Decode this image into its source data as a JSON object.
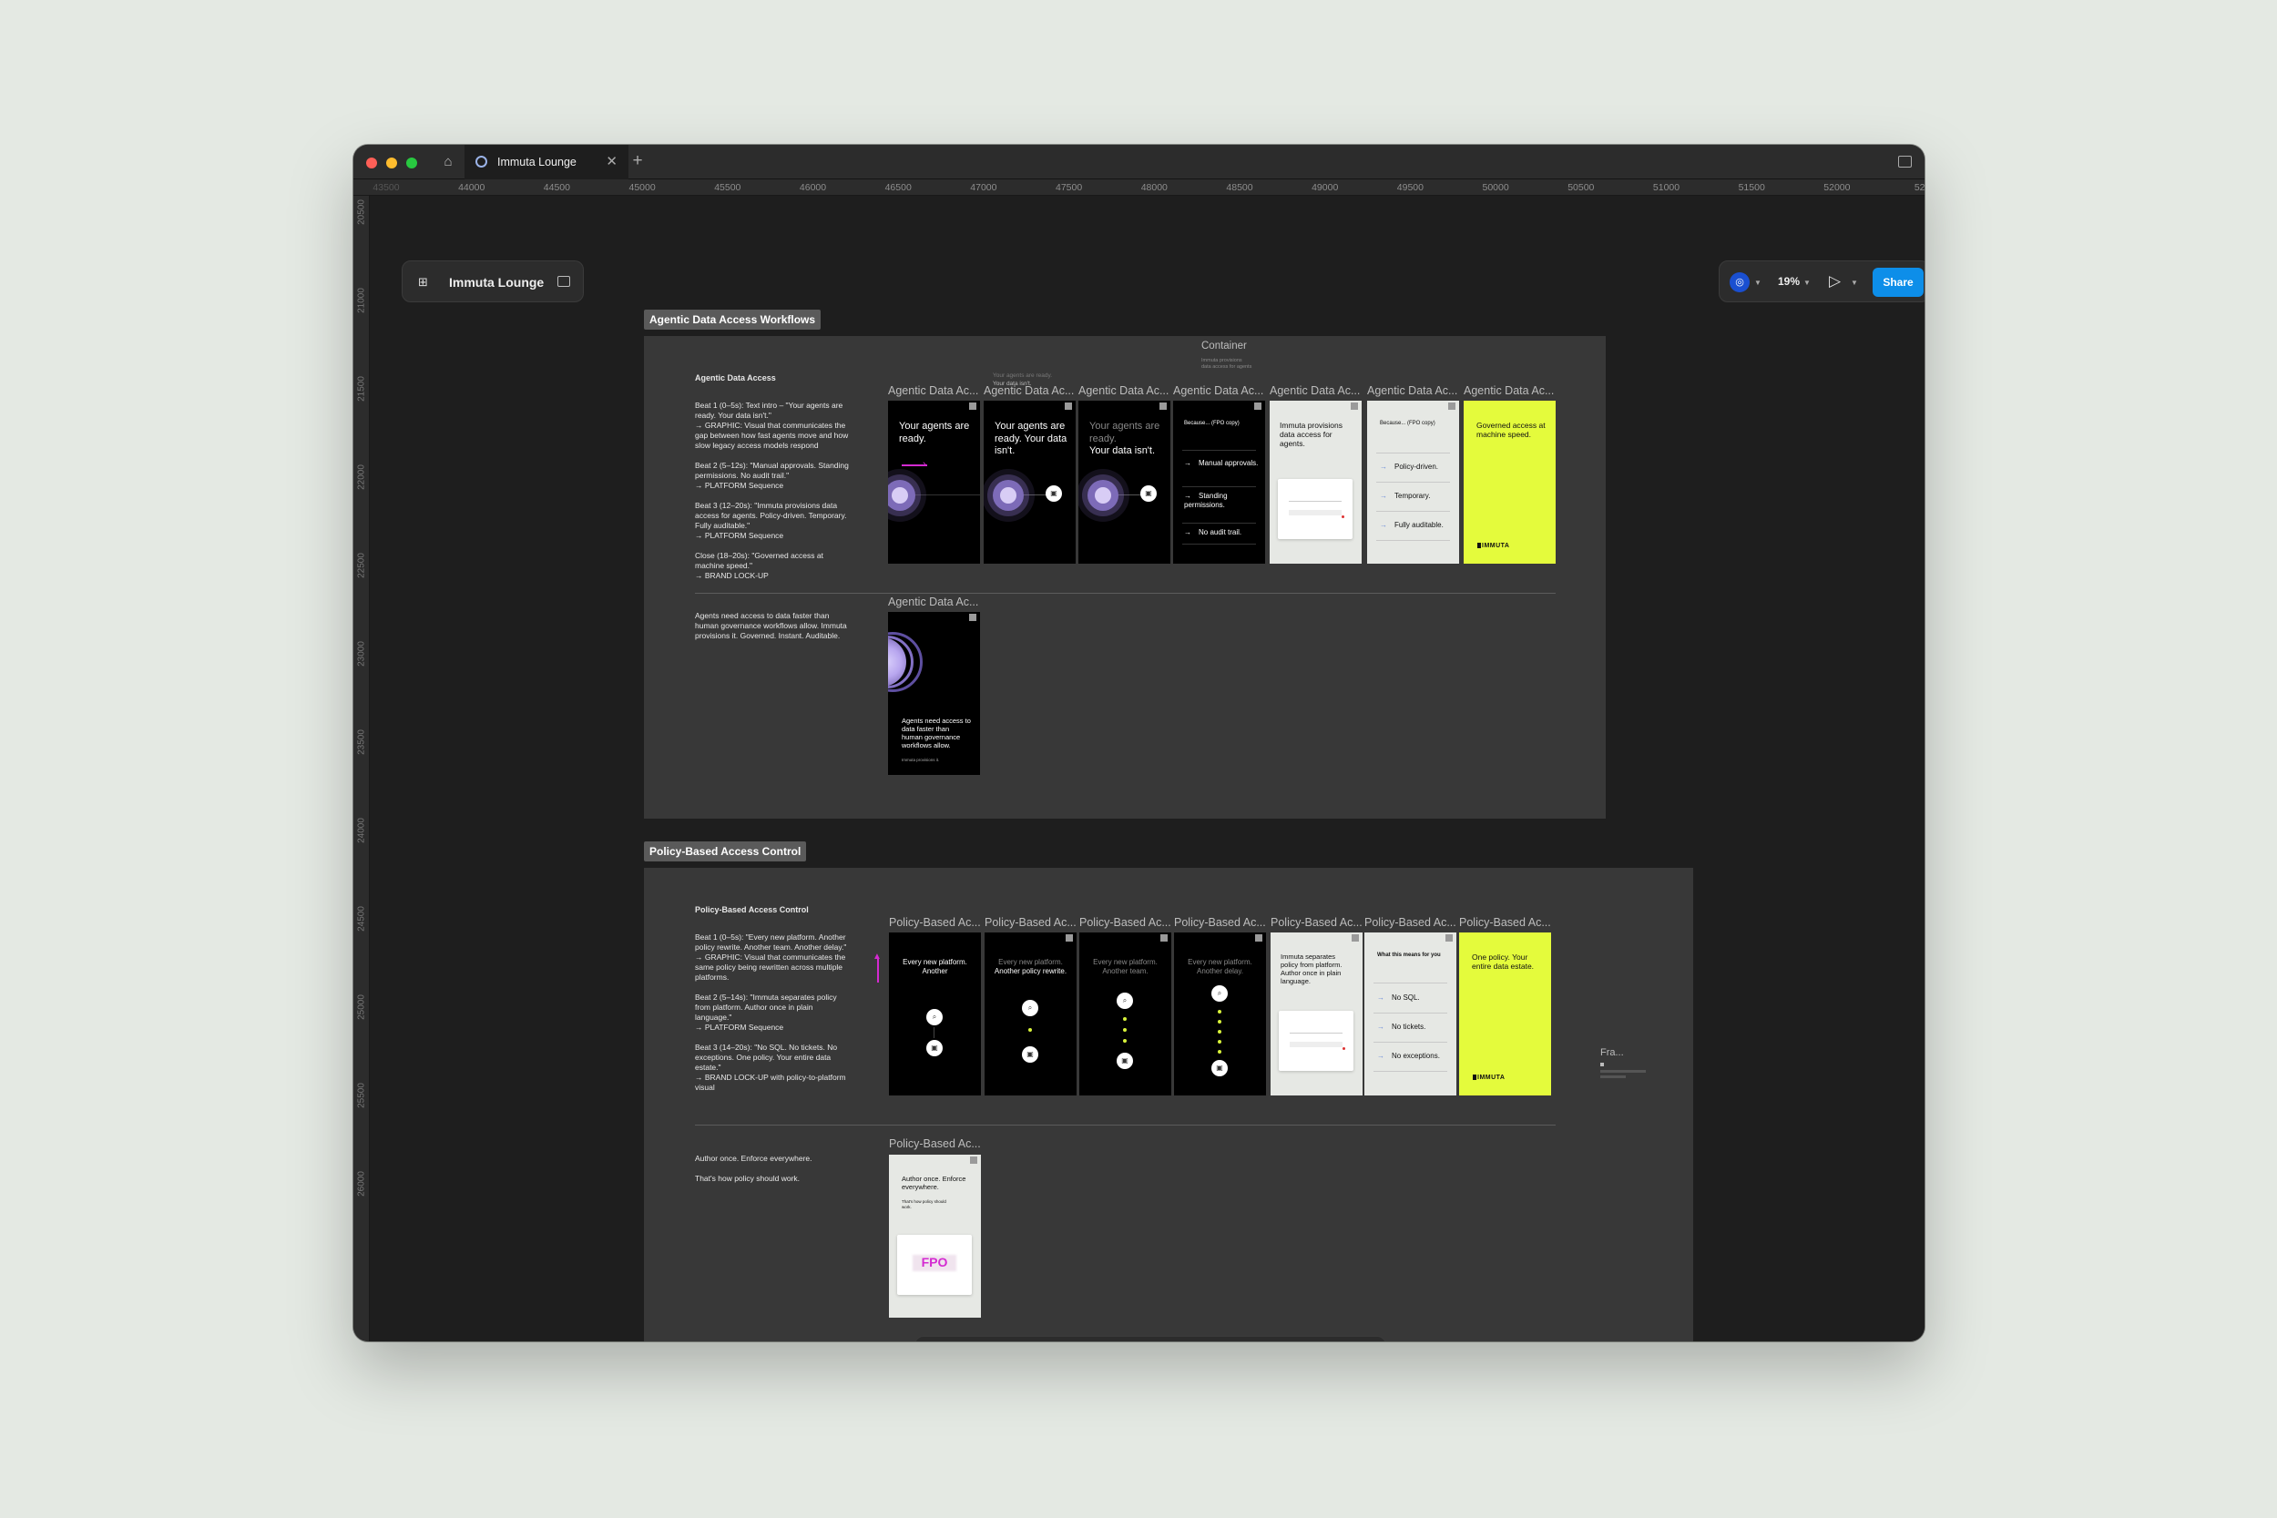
{
  "tab": {
    "title": "Immuta Lounge"
  },
  "ruler": {
    "top": [
      "43500",
      "44000",
      "44500",
      "45000",
      "45500",
      "46000",
      "46500",
      "47000",
      "47500",
      "48000",
      "48500",
      "49000",
      "49500",
      "50000",
      "50500",
      "51000",
      "51500",
      "52000",
      "525"
    ],
    "left": [
      "20500",
      "21000",
      "21500",
      "22000",
      "22500",
      "23000",
      "23500",
      "24000",
      "24500",
      "25000",
      "25500",
      "26000"
    ]
  },
  "file": {
    "name": "Immuta Lounge"
  },
  "toolbar": {
    "zoom": "19%",
    "share": "Share"
  },
  "sections": [
    {
      "label": "Agentic Data Access Workflows",
      "container": {
        "label": "Container",
        "note1": "Immuta provisions",
        "note2": "data access for agents"
      },
      "notes_title": "Agentic Data Access",
      "notes": [
        "Beat 1 (0–5s): Text intro – \"Your agents are ready. Your data isn't.\"",
        "→ GRAPHIC: Visual that communicates the gap between how fast agents move and how slow legacy access models respond",
        "Beat 2 (5–12s): \"Manual approvals. Standing permissions. No audit trail.\"",
        "→ PLATFORM Sequence",
        "Beat 3 (12–20s): \"Immuta provisions data access for agents. Policy-driven. Temporary. Fully auditable.\"",
        "→ PLATFORM Sequence",
        "Close (18–20s): \"Governed access at machine speed.\"",
        "→ BRAND LOCK-UP"
      ],
      "notes2": "Agents need access to data faster than human governance workflows allow. Immuta provisions it. Governed. Instant. Auditable.",
      "frame_label": "Agentic Data Ac...",
      "overlay1": "Your agents are ready.",
      "overlay2": "Your data isn't.",
      "frames": [
        {
          "text": "Your agents are ready."
        },
        {
          "text": "Your agents are ready. Your data isn't."
        },
        {
          "text1": "Your agents are ready.",
          "text2": "Your data isn't."
        },
        {
          "heading": "Because... (FPO copy)",
          "items": [
            "Manual approvals.",
            "Standing permissions.",
            "No audit trail."
          ]
        },
        {
          "text": "Immuta provisions data access for agents."
        },
        {
          "heading": "Because... (FPO copy)",
          "items": [
            "Policy-driven.",
            "Temporary.",
            "Fully auditable."
          ]
        },
        {
          "text": "Governed access at machine speed.",
          "brand": "IMMUTA"
        }
      ],
      "extra_frame": {
        "text": "Agents need access to data faster than human governance workflows allow.",
        "small": "Immuta provisions it."
      }
    },
    {
      "label": "Policy-Based Access Control",
      "notes_title": "Policy-Based Access Control",
      "notes": [
        "Beat 1 (0–5s): \"Every new platform. Another policy rewrite. Another team. Another delay.\"",
        "→ GRAPHIC: Visual that communicates the same policy being rewritten across multiple platforms.",
        "Beat 2 (5–14s): \"Immuta separates policy from platform. Author once in plain language.\"",
        "→ PLATFORM Sequence",
        "Beat 3 (14–20s): \"No SQL. No tickets. No exceptions. One policy. Your entire data estate.\"",
        "→ BRAND LOCK-UP with policy-to-platform visual"
      ],
      "notes2a": "Author once. Enforce everywhere.",
      "notes2b": "That's how policy should work.",
      "frame_label": "Policy-Based Ac...",
      "frames": [
        {
          "text1": "Every new platform.",
          "text2": "Another"
        },
        {
          "text1": "Every new platform.",
          "text2": "Another policy rewrite."
        },
        {
          "text1": "Every new platform.",
          "text2": "Another team."
        },
        {
          "text1": "Every new platform.",
          "text2": "Another delay."
        },
        {
          "text": "Immuta separates policy from platform. Author once in plain language."
        },
        {
          "heading": "What this means for you",
          "items": [
            "No SQL.",
            "No tickets.",
            "No exceptions."
          ]
        },
        {
          "text": "One policy. Your entire data estate.",
          "brand": "IMMUTA"
        }
      ],
      "extra_label": "Fra...",
      "extra_frame": {
        "text": "Author once. Enforce everywhere.",
        "small": "That's how policy should work.",
        "fpo": "FPO"
      }
    }
  ],
  "colors": {
    "accent": "#0d8ee9",
    "lime": "#e4fb3c",
    "magenta": "#d42ad1"
  }
}
